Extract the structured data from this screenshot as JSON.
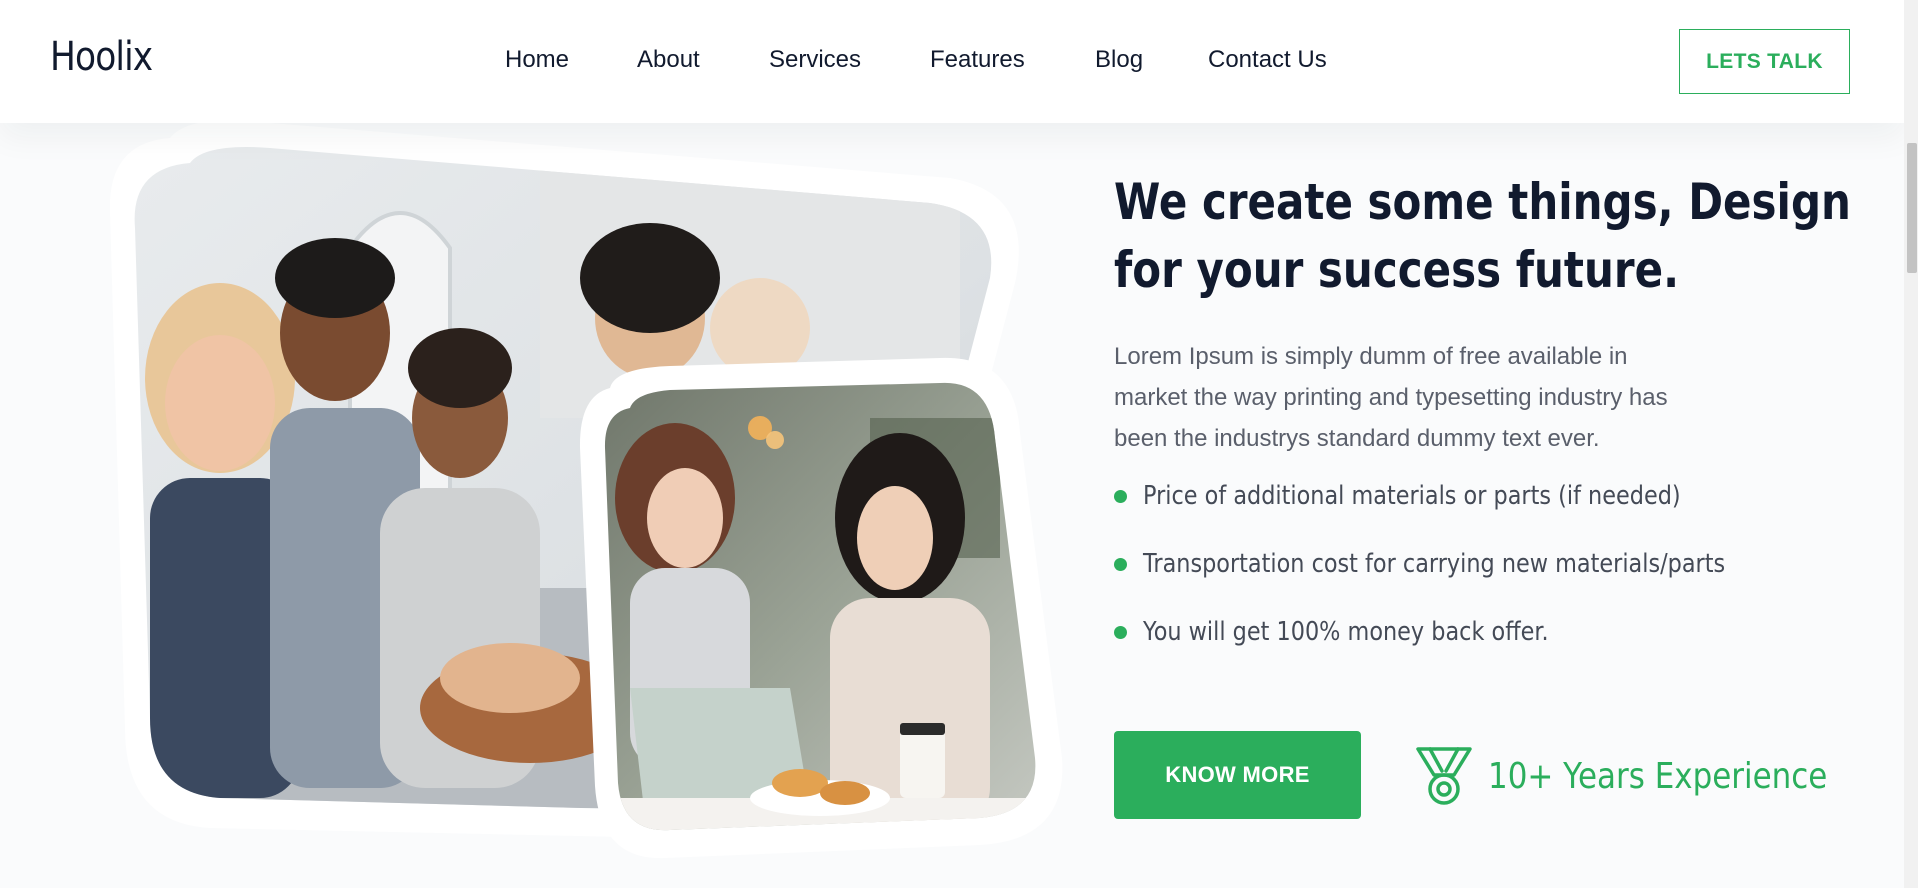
{
  "header": {
    "logo": "Hoolix",
    "nav": [
      {
        "label": "Home",
        "name": "nav-home"
      },
      {
        "label": "About",
        "name": "nav-about"
      },
      {
        "label": "Services",
        "name": "nav-services"
      },
      {
        "label": "Features",
        "name": "nav-features"
      },
      {
        "label": "Blog",
        "name": "nav-blog"
      },
      {
        "label": "Contact Us",
        "name": "nav-contact-us"
      }
    ],
    "cta_label": "LETS TALK"
  },
  "hero": {
    "headline_lines": [
      "We create some things, Design",
      "for your success future."
    ],
    "paragraph_lines": [
      "Lorem Ipsum is simply dumm of free available in",
      "market the way printing and typesetting industry has",
      "been the industrys standard dummy text ever."
    ],
    "features": [
      "Price of additional materials or parts (if needed)",
      "Transportation cost for carrying new materials/parts",
      "You will get 100% money back offer."
    ],
    "button_label": "KNOW MORE",
    "experience_label": "10+ Years Experience",
    "experience_icon": "medal-icon",
    "images": [
      {
        "name": "team-hands-photo",
        "description_icon": "team-photo"
      },
      {
        "name": "women-laptop-photo",
        "description_icon": "meeting-photo"
      }
    ]
  },
  "colors": {
    "accent": "#2bae5c",
    "heading": "#111a2e",
    "body_text": "#5a5f6b",
    "feature_text": "#444a56",
    "background": "#fafbfc"
  }
}
